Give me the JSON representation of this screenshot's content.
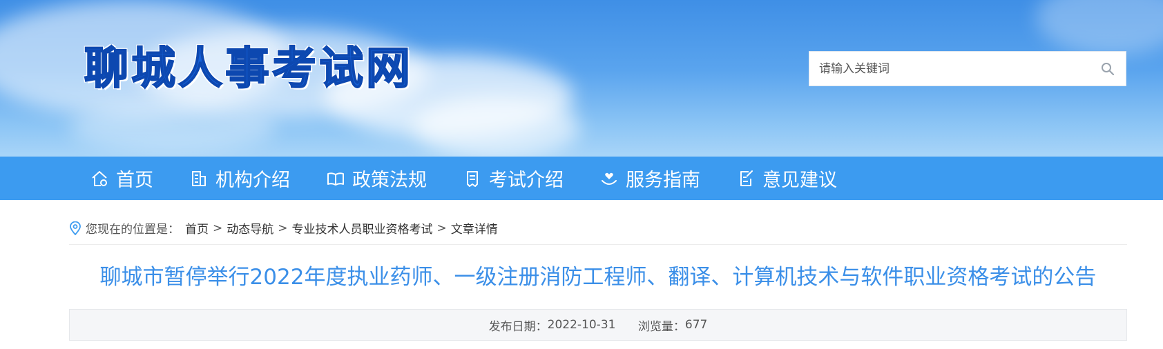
{
  "header": {
    "site_title": "聊城人事考试网",
    "search_placeholder": "请输入关键词"
  },
  "nav": {
    "items": [
      {
        "label": "首页",
        "icon": "home-icon"
      },
      {
        "label": "机构介绍",
        "icon": "building-icon"
      },
      {
        "label": "政策法规",
        "icon": "book-icon"
      },
      {
        "label": "考试介绍",
        "icon": "document-icon"
      },
      {
        "label": "服务指南",
        "icon": "hand-heart-icon"
      },
      {
        "label": "意见建议",
        "icon": "edit-icon"
      }
    ]
  },
  "breadcrumb": {
    "label": "您现在的位置是：",
    "items": [
      "首页",
      "动态导航",
      "专业技术人员职业资格考试",
      "文章详情"
    ],
    "separator": ">"
  },
  "article": {
    "title": "聊城市暂停举行2022年度执业药师、一级注册消防工程师、翻译、计算机技术与软件职业资格考试的公告",
    "publish_label": "发布日期：",
    "publish_date": "2022-10-31",
    "views_label": "浏览量：",
    "views": "677"
  },
  "colors": {
    "nav_bg": "#3c9bf0",
    "title_blue": "#3b8fe8",
    "logo_blue": "#1560d6"
  }
}
